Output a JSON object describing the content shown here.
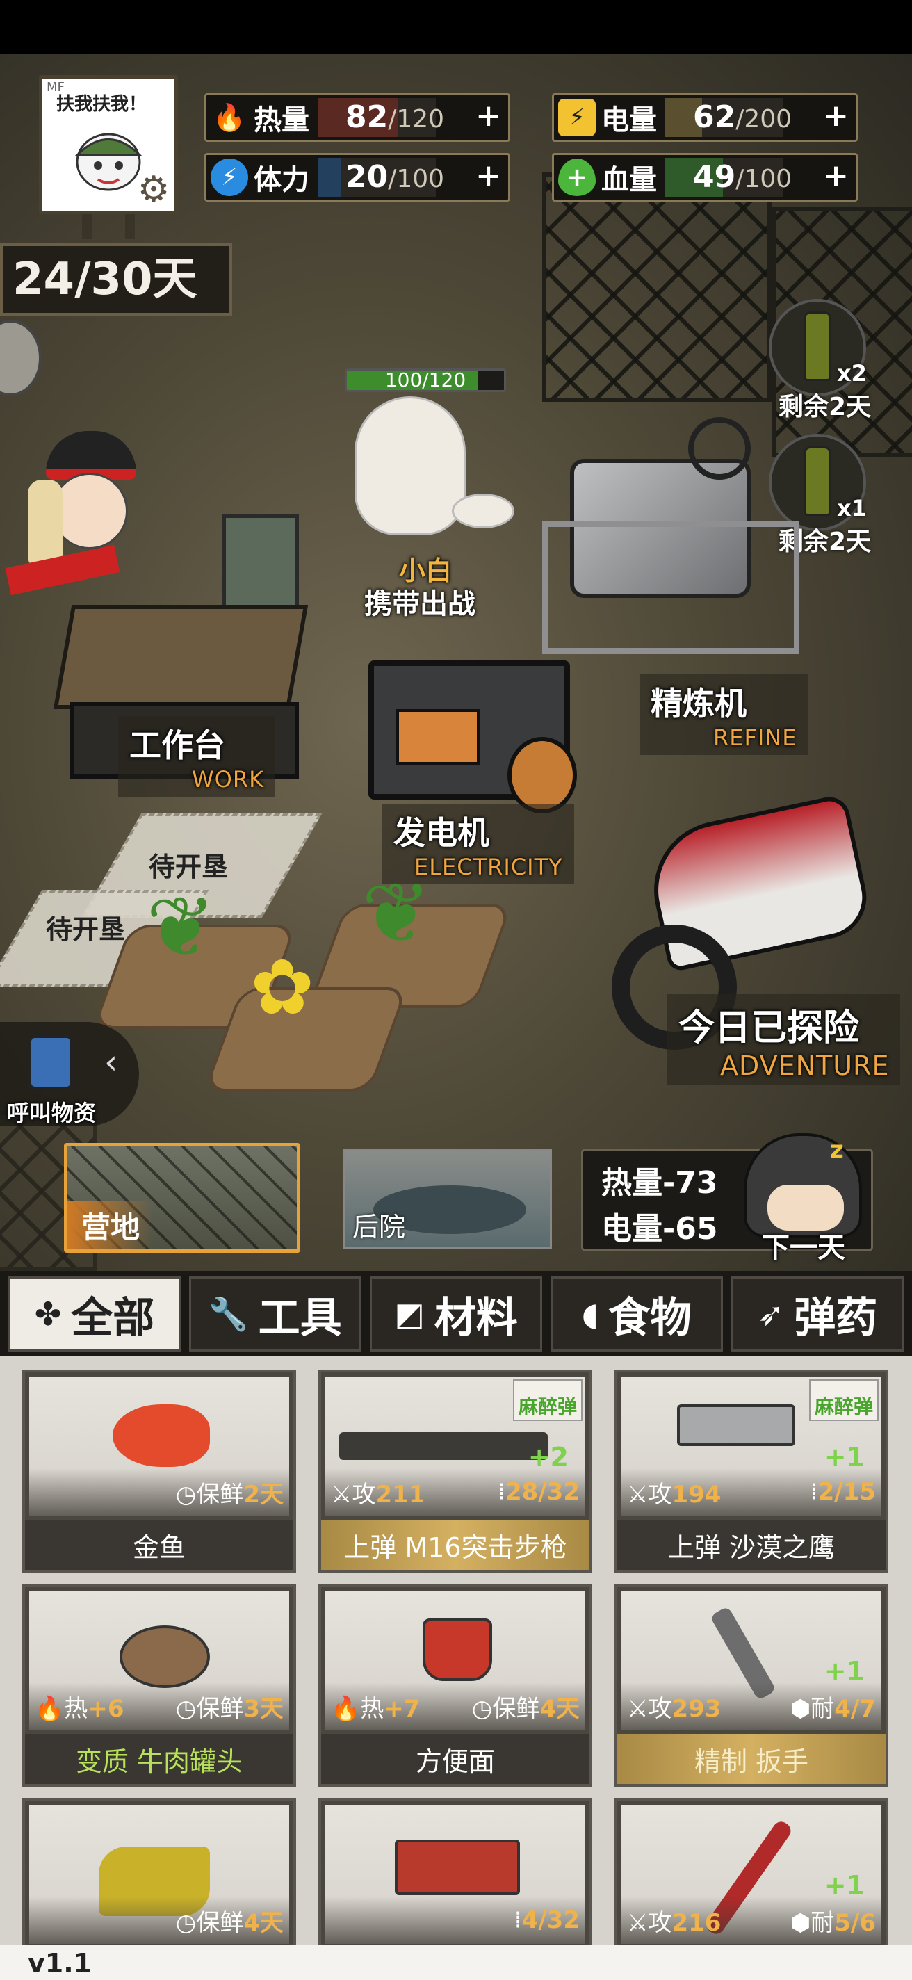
{
  "stats": {
    "heat": {
      "label": "热量",
      "value": "82",
      "max": "/120",
      "fill": 0.683,
      "color": "#e8412c"
    },
    "power": {
      "label": "电量",
      "value": "62",
      "max": "/200",
      "fill": 0.31,
      "color": "#f2c230"
    },
    "stamina": {
      "label": "体力",
      "value": "20",
      "max": "/100",
      "fill": 0.2,
      "color": "#2a8ce0"
    },
    "health": {
      "label": "血量",
      "value": "49",
      "max": "/100",
      "fill": 0.49,
      "color": "#4cb53c"
    },
    "plus": "+"
  },
  "avatar": {
    "sign_text": "扶我扶我！",
    "corner": "MF"
  },
  "days": "24/30天",
  "pet": {
    "hp": "100/120",
    "hp_fill": 0.833,
    "name": "小白",
    "action": "携带出战"
  },
  "bottles": [
    {
      "count": "x2",
      "remain": "剩余2天"
    },
    {
      "count": "x1",
      "remain": "剩余2天"
    }
  ],
  "stations": {
    "work": {
      "cn": "工作台",
      "en": "WORK"
    },
    "refine": {
      "cn": "精炼机",
      "en": "REFINE"
    },
    "electricity": {
      "cn": "发电机",
      "en": "ELECTRICITY"
    },
    "adventure": {
      "cn": "今日已探险",
      "en": "ADVENTURE"
    }
  },
  "plots": [
    "待开垦",
    "待开垦"
  ],
  "call_supplies": "呼叫物资",
  "locations": {
    "camp": "营地",
    "backyard": "后院"
  },
  "next_day": {
    "heat": "热量-73",
    "power": "电量-65",
    "label": "下一天"
  },
  "tabs": [
    "全部",
    "工具",
    "材料",
    "食物",
    "弹药"
  ],
  "items": [
    {
      "name": "金鱼",
      "stat": "保鲜",
      "statval": "2天"
    },
    {
      "name": "上弹 M16突击步枪",
      "atk_label": "攻",
      "atk": "211",
      "ammo": "28/32",
      "badge": "麻醉弹",
      "bonus": "+2"
    },
    {
      "name": "上弹 沙漠之鹰",
      "atk_label": "攻",
      "atk": "194",
      "ammo": "2/15",
      "badge": "麻醉弹",
      "bonus": "+1"
    },
    {
      "name": "变质 牛肉罐头",
      "heat_label": "热",
      "heat": "+6",
      "stat": "保鲜",
      "statval": "3天"
    },
    {
      "name": "方便面",
      "heat_label": "热",
      "heat": "+7",
      "stat": "保鲜",
      "statval": "4天"
    },
    {
      "name": "精制 扳手",
      "atk_label": "攻",
      "atk": "293",
      "dur_label": "耐",
      "dur": "4/7",
      "bonus": "+1"
    },
    {
      "stat": "保鲜",
      "statval": "4天"
    },
    {
      "ammo": "4/32"
    },
    {
      "atk_label": "攻",
      "atk": "216",
      "dur_label": "耐",
      "dur": "5/6",
      "bonus": "+1"
    }
  ],
  "version": "v1.1"
}
